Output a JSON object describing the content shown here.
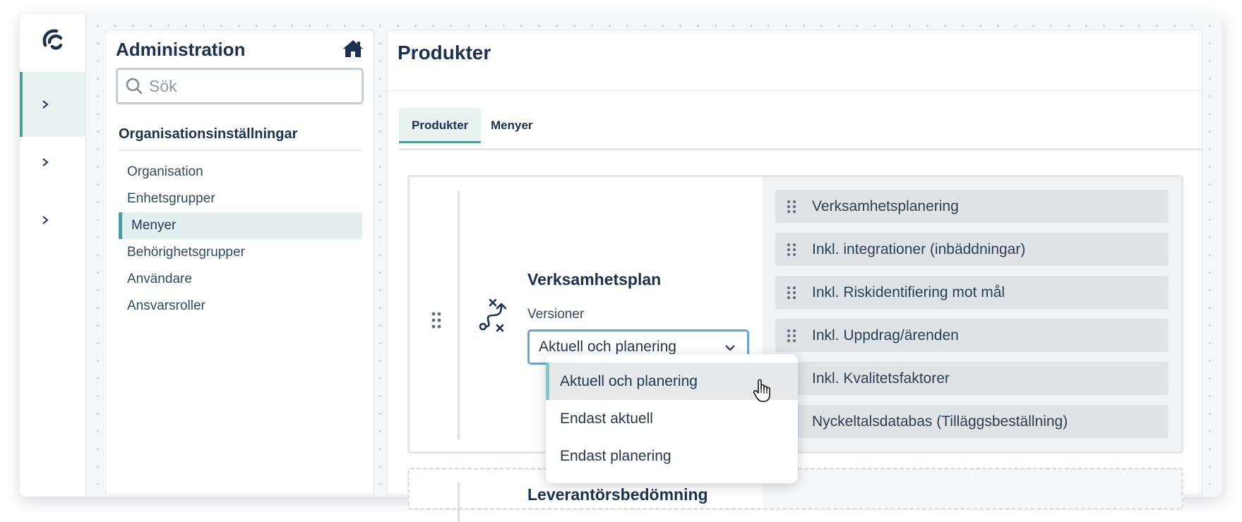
{
  "sidebar_panel": {
    "title": "Administration",
    "search_placeholder": "Sök",
    "section_heading": "Organisationsinställningar",
    "items": [
      {
        "label": "Organisation"
      },
      {
        "label": "Enhetsgrupper"
      },
      {
        "label": "Menyer",
        "active": true
      },
      {
        "label": "Behörighetsgrupper"
      },
      {
        "label": "Användare"
      },
      {
        "label": "Ansvarsroller"
      }
    ]
  },
  "main": {
    "title": "Produkter",
    "tabs": [
      {
        "label": "Produkter",
        "active": true
      },
      {
        "label": "Menyer"
      }
    ],
    "product": {
      "name": "Verksamhetsplan",
      "versions_label": "Versioner",
      "selected_version": "Aktuell och planering",
      "modules": [
        "Verksamhetsplanering",
        "Inkl. integrationer (inbäddningar)",
        "Inkl. Riskidentifiering mot mål",
        "Inkl. Uppdrag/ärenden",
        "Inkl. Kvalitetsfaktorer",
        "Nyckeltalsdatabas (Tilläggsbeställning)"
      ]
    },
    "next_product": {
      "name": "Leverantörsbedömning"
    }
  },
  "dropdown": {
    "options": [
      "Aktuell och planering",
      "Endast aktuell",
      "Endast planering"
    ],
    "selected": "Aktuell och planering"
  },
  "colors": {
    "accent": "#4a9b9a",
    "navy": "#1c3150",
    "focus_border": "#68a5d6"
  }
}
